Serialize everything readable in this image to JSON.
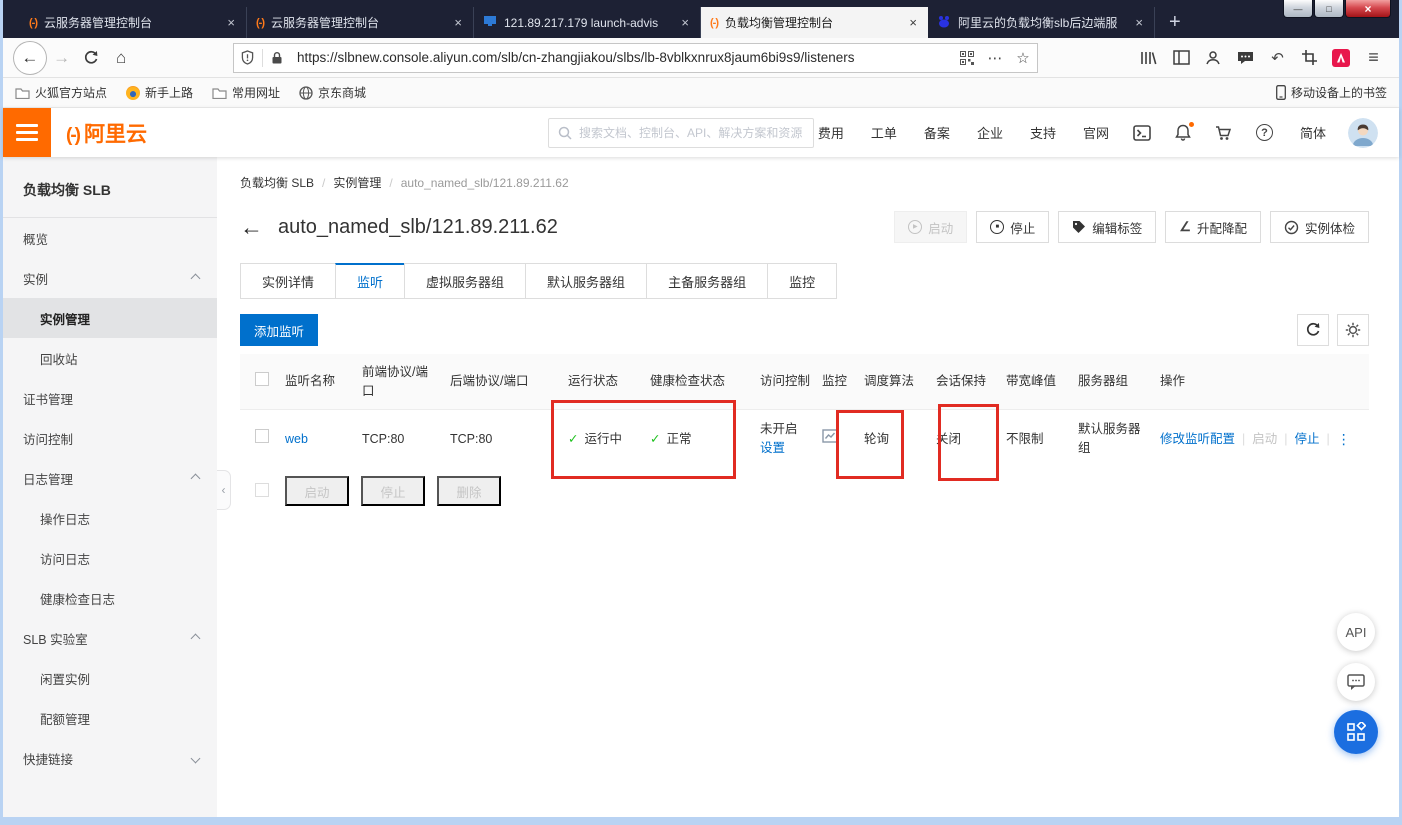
{
  "icons": {
    "back": "←",
    "forward": "→",
    "home": "⌂",
    "dots": "⋯",
    "star": "☆",
    "undo": "↶",
    "menu": "≡",
    "plus": "+",
    "close": "×",
    "min": "—",
    "max": "□",
    "play": "▶",
    "stop_sq": "■",
    "pencil": "∠",
    "more_v": "⋮",
    "check": "✓",
    "question": "?",
    "collapse_left": "‹",
    "title_back": "←",
    "logo_mark": "(-)"
  },
  "titlebar": {
    "tabs": [
      {
        "title": "云服务器管理控制台"
      },
      {
        "title": "云服务器管理控制台"
      },
      {
        "title": "121.89.217.179 launch-advis"
      },
      {
        "title": "负载均衡管理控制台"
      },
      {
        "title": "阿里云的负载均衡slb后边端服"
      }
    ]
  },
  "navbar": {
    "url": "https://slbnew.console.aliyun.com/slb/cn-zhangjiakou/slbs/lb-8vblkxnrux8jaum6bi9s9/listeners"
  },
  "bookmarks": {
    "items": [
      "火狐官方站点",
      "新手上路",
      "常用网址",
      "京东商城"
    ],
    "right": "移动设备上的书签"
  },
  "header": {
    "logo_text": "阿里云",
    "search_placeholder": "搜索文档、控制台、API、解决方案和资源",
    "menu": [
      "费用",
      "工单",
      "备案",
      "企业",
      "支持",
      "官网"
    ],
    "lang": "简体"
  },
  "sidebar": {
    "title": "负载均衡 SLB",
    "items": [
      {
        "label": "概览"
      },
      {
        "label": "实例"
      },
      {
        "label": "实例管理"
      },
      {
        "label": "回收站"
      },
      {
        "label": "证书管理"
      },
      {
        "label": "访问控制"
      },
      {
        "label": "日志管理"
      },
      {
        "label": "操作日志"
      },
      {
        "label": "访问日志"
      },
      {
        "label": "健康检查日志"
      },
      {
        "label": "SLB 实验室"
      },
      {
        "label": "闲置实例"
      },
      {
        "label": "配额管理"
      },
      {
        "label": "快捷链接"
      }
    ]
  },
  "main": {
    "breadcrumb": {
      "items": [
        "负载均衡 SLB",
        "实例管理",
        "auto_named_slb/121.89.211.62"
      ],
      "sep": "/"
    },
    "title": "auto_named_slb/121.89.211.62",
    "actions": [
      "启动",
      "停止",
      "编辑标签",
      "升配降配",
      "实例体检"
    ],
    "tabs": [
      "实例详情",
      "监听",
      "虚拟服务器组",
      "默认服务器组",
      "主备服务器组",
      "监控"
    ],
    "add_listener": "添加监听",
    "table": {
      "columns": [
        "监听名称",
        "前端协议/端口",
        "后端协议/端口",
        "运行状态",
        "健康检查状态",
        "访问控制",
        "监控",
        "调度算法",
        "会话保持",
        "带宽峰值",
        "服务器组",
        "操作"
      ],
      "row": {
        "name": "web",
        "frontend": "TCP:80",
        "backend": "TCP:80",
        "status": "运行中",
        "health": "正常",
        "acl_state": "未开启",
        "acl_link": "设置",
        "scheduler": "轮询",
        "session": "关闭",
        "bandwidth": "不限制",
        "server_group": "默认服务器组",
        "ops": [
          "修改监听配置",
          "启动",
          "停止"
        ],
        "ops_sep": "|"
      },
      "footer_buttons": [
        "启动",
        "停止",
        "删除"
      ]
    }
  },
  "floating": {
    "api": "API"
  },
  "colors": {
    "brand_orange": "#ff6a00",
    "primary_blue": "#0070cc",
    "success_green": "#1dc11d",
    "annotation_red": "#e12b22"
  }
}
